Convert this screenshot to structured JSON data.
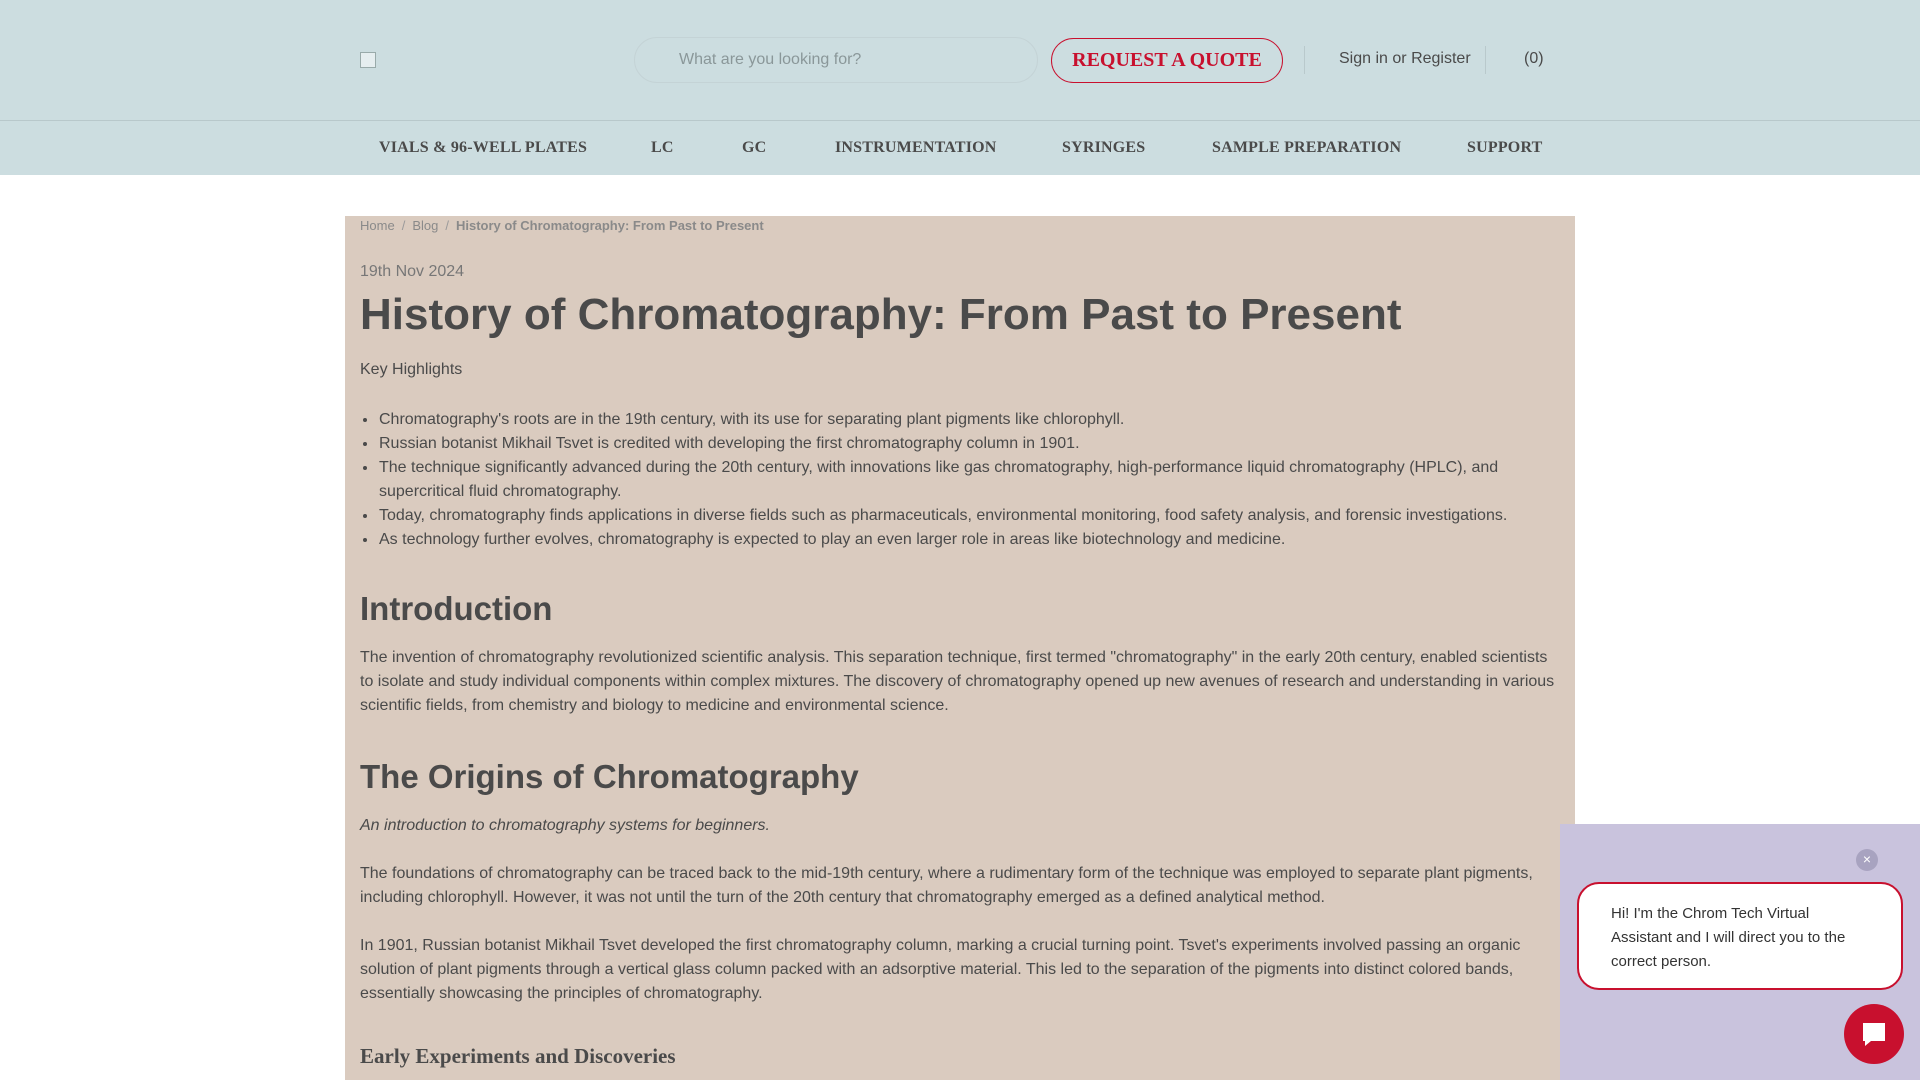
{
  "header": {
    "search_placeholder": "What are you looking for?",
    "quote_button": "REQUEST A QUOTE",
    "sign_in": "Sign in",
    "or": "or",
    "register": "Register",
    "cart_count": "(0)"
  },
  "nav": {
    "items": [
      "VIALS & 96-WELL PLATES",
      "LC",
      "GC",
      "INSTRUMENTATION",
      "SYRINGES",
      "SAMPLE PREPARATION",
      "SUPPORT"
    ]
  },
  "breadcrumb": {
    "home": "Home",
    "sep": "/",
    "blog": "Blog",
    "current": "History of Chromatography: From Past to Present"
  },
  "article": {
    "date": "19th Nov 2024",
    "title": "History of Chromatography: From Past to Present",
    "key_highlights": "Key Highlights",
    "bullets": [
      "Chromatography's roots are in the 19th century, with its use for separating plant pigments like chlorophyll.",
      "Russian botanist Mikhail Tsvet is credited with developing the first chromatography column in 1901.",
      "The technique significantly advanced during the 20th century, with innovations like gas chromatography, high-performance liquid chromatography (HPLC), and supercritical fluid chromatography.",
      "Today, chromatography finds applications in diverse fields such as pharmaceuticals, environmental monitoring, food safety analysis, and forensic investigations.",
      "As technology further evolves, chromatography is expected to play an even larger role in areas like biotechnology and medicine."
    ],
    "intro_heading": "Introduction",
    "intro_text": "The invention of chromatography revolutionized scientific analysis. This separation technique, first termed \"chromatography\" in the early 20th century, enabled scientists to isolate and study individual components within complex mixtures. The discovery of chromatography opened up new avenues of research and understanding in various scientific fields, from chemistry and biology to medicine and environmental science.",
    "origins_heading": "The Origins of Chromatography",
    "origins_caption": "An introduction to chromatography systems for beginners.",
    "origins_p1": "The foundations of chromatography can be traced back to the mid-19th century, where a rudimentary form of the technique was employed to separate plant pigments, including chlorophyll. However, it was not until the turn of the 20th century that chromatography emerged as a defined analytical method.",
    "origins_p2": "In 1901, Russian botanist Mikhail Tsvet developed the first chromatography column, marking a crucial turning point. Tsvet's experiments involved passing an organic solution of plant pigments through a vertical glass column packed with an adsorptive material. This led to the separation of the pigments into distinct colored bands, essentially showcasing the principles of chromatography.",
    "early_heading": "Early Experiments and Discoveries"
  },
  "chat": {
    "close": "×",
    "message": "Hi! I'm the Chrom Tech Virtual Assistant and I will direct you to the correct person."
  }
}
